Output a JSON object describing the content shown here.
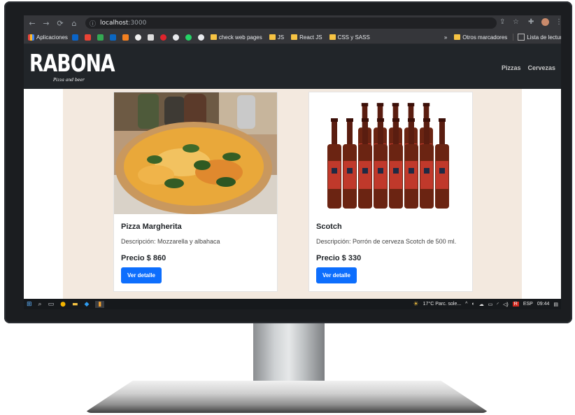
{
  "browser": {
    "url_host": "localhost",
    "url_port": ":3000",
    "bookmarks": [
      {
        "label": "Aplicaciones",
        "type": "apps"
      },
      {
        "label": "check web pages",
        "type": "folder"
      },
      {
        "label": "JS",
        "type": "folder"
      },
      {
        "label": "React JS",
        "type": "folder"
      },
      {
        "label": "CSS y SASS",
        "type": "folder"
      }
    ],
    "more_bookmarks": "»",
    "other_bookmarks": "Otros marcadores",
    "reading_list": "Lista de lectura"
  },
  "site": {
    "brand": "RABONA",
    "tagline": "Pizza and beer",
    "nav": [
      "Pizzas",
      "Cervezas"
    ]
  },
  "products": [
    {
      "title": "Pizza Margherita",
      "description": "Descripción: Mozzarella y albahaca",
      "price": "Precio $ 860",
      "button": "Ver detalle",
      "image": "pizza-image"
    },
    {
      "title": "Scotch",
      "description": "Descripción: Porrón de cerveza Scotch de 500 ml.",
      "price": "Precio $ 330",
      "button": "Ver detalle",
      "image": "beer-bottles-image"
    }
  ],
  "taskbar": {
    "weather": "17°C  Parc. sole...",
    "language": "ESP",
    "time": "09:44"
  },
  "colors": {
    "header_bg": "#212529",
    "content_bg": "#f3e9df",
    "button_bg": "#0d6efd"
  }
}
